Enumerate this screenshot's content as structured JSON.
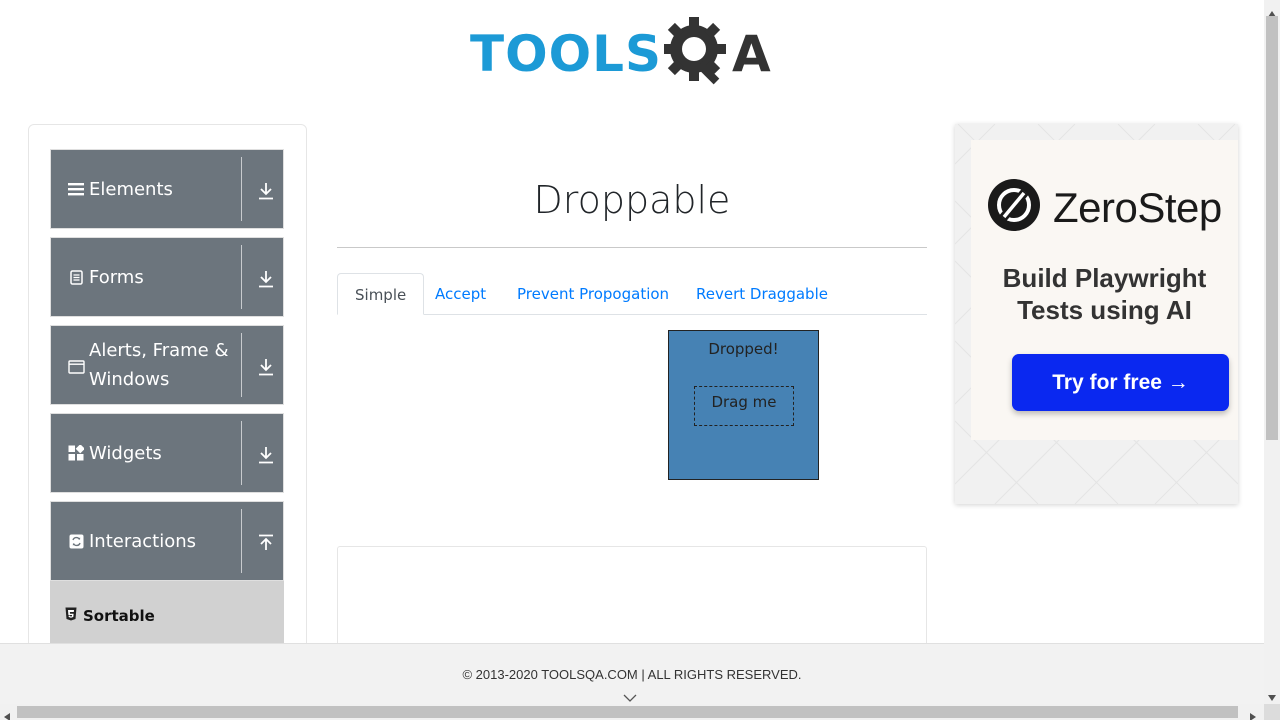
{
  "header": {
    "logo_text": "TOOLS",
    "logo_suffix": "A",
    "logo_icon": "gear-magnifier-icon"
  },
  "sidebar": {
    "groups": [
      {
        "label": "Elements",
        "icon": "hamburger-icon",
        "toggle": "download-arrow-icon"
      },
      {
        "label": "Forms",
        "icon": "document-icon",
        "toggle": "download-arrow-icon"
      },
      {
        "label": "Alerts, Frame & Windows",
        "icon": "window-icon",
        "toggle": "download-arrow-icon"
      },
      {
        "label": "Widgets",
        "icon": "widgets-icon",
        "toggle": "download-arrow-icon"
      },
      {
        "label": "Interactions",
        "icon": "refresh-icon",
        "toggle": "upload-arrow-icon"
      }
    ],
    "active_item": {
      "label": "Sortable",
      "icon": "html5-icon"
    }
  },
  "main": {
    "title": "Droppable",
    "tabs": [
      {
        "label": "Simple",
        "active": true
      },
      {
        "label": "Accept",
        "active": false
      },
      {
        "label": "Prevent Propogation",
        "active": false
      },
      {
        "label": "Revert Draggable",
        "active": false
      }
    ],
    "droppable": {
      "text": "Dropped!",
      "color": "#4682b4"
    },
    "draggable": {
      "text": "Drag me"
    }
  },
  "ad": {
    "brand": "ZeroStep",
    "tagline": "Build Playwright Tests using AI",
    "cta": "Try for free →",
    "cta_color": "#0a28f0"
  },
  "footer": {
    "copyright": "© 2013-2020 TOOLSQA.COM | ALL RIGHTS RESERVED."
  },
  "colors": {
    "sidebar_group": "#6c757d",
    "link": "#007bff",
    "logo_blue": "#1c9ad6"
  }
}
